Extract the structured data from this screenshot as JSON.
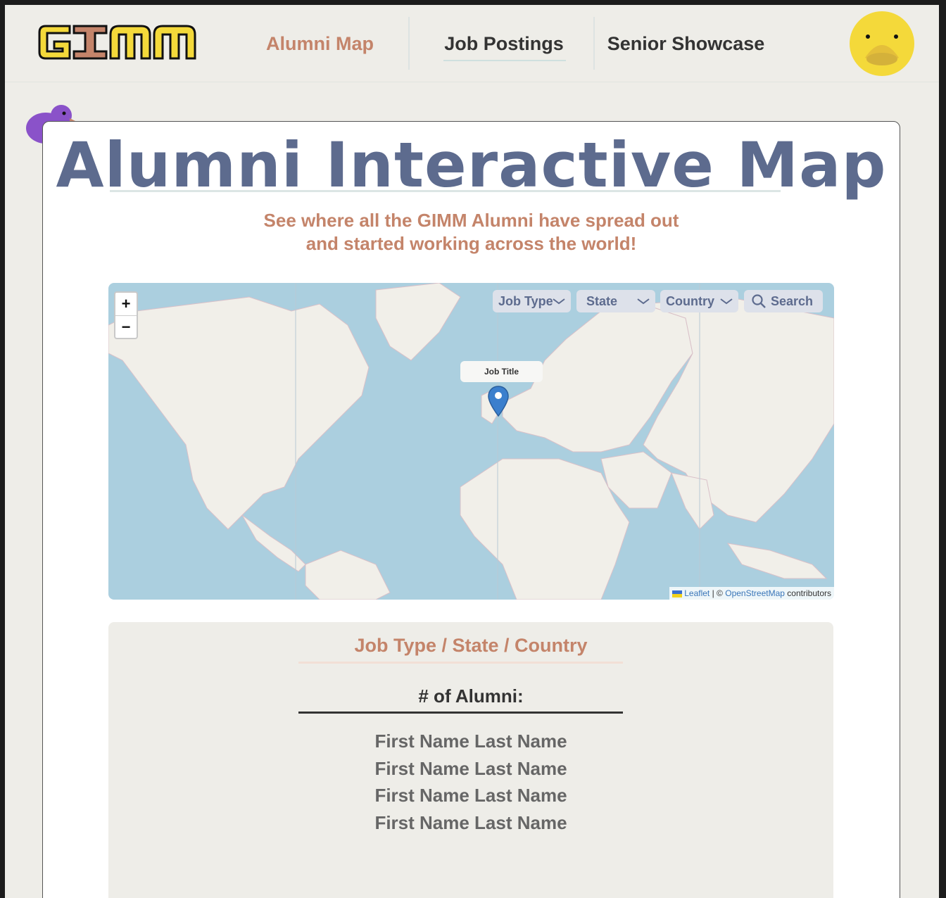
{
  "header": {
    "logo_text": "GIMM",
    "nav": [
      {
        "label": "Alumni Map",
        "active": true
      },
      {
        "label": "Job Postings",
        "active": false
      },
      {
        "label": "Senior Showcase",
        "active": false
      }
    ]
  },
  "main": {
    "title": "Alumni Interactive Map",
    "subtitle_line1": "See where all the GIMM Alumni have spread out",
    "subtitle_line2": "and started working across the world!"
  },
  "map": {
    "zoom_in": "+",
    "zoom_out": "−",
    "filters": {
      "job_type": "Job Type",
      "state": "State",
      "country": "Country",
      "search": "Search"
    },
    "popup_label": "Job Title",
    "attribution": {
      "leaflet": "Leaflet",
      "separator": "| ©",
      "osm": "OpenStreetMap",
      "contributors": "contributors"
    }
  },
  "panel": {
    "title": "Job Type / State / Country",
    "count_label": "# of Alumni:",
    "alumni": [
      "First Name Last Name",
      "First Name Last Name",
      "First Name Last Name",
      "First Name Last Name"
    ]
  },
  "colors": {
    "accent": "#c4846a",
    "title": "#5d6b8e",
    "background": "#eeede8",
    "avatar": "#f4d93a",
    "duck": "#8a52c9"
  }
}
